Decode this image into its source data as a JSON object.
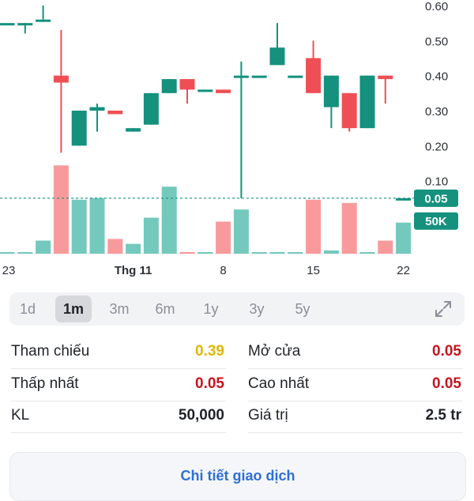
{
  "chart_data": {
    "type": "candlestick",
    "y_ticks": [
      "0.60",
      "0.50",
      "0.40",
      "0.30",
      "0.20",
      "0.10"
    ],
    "x_tick_labels": [
      "23",
      "Thg 11",
      "8",
      "15",
      "22"
    ],
    "current_price_label": "0.05",
    "current_volume_label": "50K",
    "ylim": [
      0,
      0.6
    ],
    "candles": [
      {
        "o": 0.55,
        "c": 0.55,
        "h": 0.55,
        "l": 0.55,
        "vol": 0
      },
      {
        "o": 0.55,
        "c": 0.55,
        "h": 0.55,
        "l": 0.52,
        "vol": 0
      },
      {
        "o": 0.56,
        "c": 0.56,
        "h": 0.6,
        "l": 0.56,
        "vol": 40
      },
      {
        "o": 0.4,
        "c": 0.38,
        "h": 0.53,
        "l": 0.18,
        "vol": 270
      },
      {
        "o": 0.2,
        "c": 0.3,
        "h": 0.3,
        "l": 0.2,
        "vol": 165
      },
      {
        "o": 0.3,
        "c": 0.31,
        "h": 0.32,
        "l": 0.24,
        "vol": 170
      },
      {
        "o": 0.3,
        "c": 0.29,
        "h": 0.3,
        "l": 0.29,
        "vol": 45
      },
      {
        "o": 0.24,
        "c": 0.25,
        "h": 0.25,
        "l": 0.24,
        "vol": 30
      },
      {
        "o": 0.26,
        "c": 0.35,
        "h": 0.35,
        "l": 0.26,
        "vol": 110
      },
      {
        "o": 0.35,
        "c": 0.39,
        "h": 0.39,
        "l": 0.35,
        "vol": 205
      },
      {
        "o": 0.39,
        "c": 0.36,
        "h": 0.39,
        "l": 0.32,
        "vol": 5
      },
      {
        "o": 0.36,
        "c": 0.36,
        "h": 0.36,
        "l": 0.36,
        "vol": 0
      },
      {
        "o": 0.36,
        "c": 0.35,
        "h": 0.36,
        "l": 0.35,
        "vol": 98
      },
      {
        "o": 0.4,
        "c": 0.4,
        "h": 0.44,
        "l": 0.05,
        "vol": 135
      },
      {
        "o": 0.4,
        "c": 0.4,
        "h": 0.4,
        "l": 0.4,
        "vol": 0
      },
      {
        "o": 0.43,
        "c": 0.48,
        "h": 0.55,
        "l": 0.43,
        "vol": 5
      },
      {
        "o": 0.4,
        "c": 0.4,
        "h": 0.4,
        "l": 0.4,
        "vol": 0
      },
      {
        "o": 0.45,
        "c": 0.35,
        "h": 0.5,
        "l": 0.35,
        "vol": 165
      },
      {
        "o": 0.31,
        "c": 0.4,
        "h": 0.4,
        "l": 0.25,
        "vol": 10
      },
      {
        "o": 0.35,
        "c": 0.25,
        "h": 0.35,
        "l": 0.24,
        "vol": 155
      },
      {
        "o": 0.25,
        "c": 0.4,
        "h": 0.4,
        "l": 0.25,
        "vol": 0
      },
      {
        "o": 0.4,
        "c": 0.39,
        "h": 0.4,
        "l": 0.32,
        "vol": 40
      },
      {
        "o": 0.05,
        "c": 0.05,
        "h": 0.05,
        "l": 0.05,
        "vol": 95
      }
    ]
  },
  "timeframes": [
    {
      "label": "1d",
      "active": false
    },
    {
      "label": "1m",
      "active": true
    },
    {
      "label": "3m",
      "active": false
    },
    {
      "label": "6m",
      "active": false
    },
    {
      "label": "1y",
      "active": false
    },
    {
      "label": "3y",
      "active": false
    },
    {
      "label": "5y",
      "active": false
    }
  ],
  "stats": {
    "ref_label": "Tham chiếu",
    "ref_value": "0.39",
    "open_label": "Mở cửa",
    "open_value": "0.05",
    "low_label": "Thấp nhất",
    "low_value": "0.05",
    "high_label": "Cao nhất",
    "high_value": "0.05",
    "vol_label": "KL",
    "vol_value": "50,000",
    "val_label": "Giá trị",
    "val_value": "2.5 tr"
  },
  "detail_button": "Chi tiết giao dịch",
  "colors": {
    "up": "#15917d",
    "down": "#ef4f54",
    "up_vol": "#74c9bd",
    "down_vol": "#f89a9c",
    "ref": "#e0b700",
    "accent": "#15917d"
  }
}
